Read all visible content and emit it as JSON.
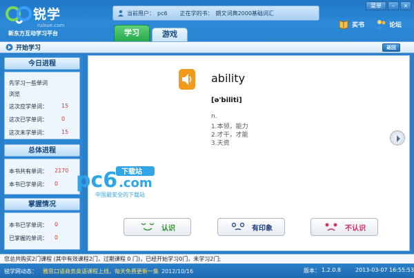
{
  "header": {
    "logo_text": "锐学",
    "logo_domain": "ruixue.com",
    "logo_slogan": "新东方互动学习平台",
    "current_user_label": "当前用户：",
    "current_user": "pc6",
    "current_book_label": "正在学的书：",
    "current_book": "朗文词典2000基础词汇",
    "tabs": [
      {
        "label": "学习"
      },
      {
        "label": "游戏"
      }
    ],
    "menu_label": "菜单",
    "min_label": "–",
    "close_label": "×",
    "buy_label": "买书",
    "forum_label": "论坛"
  },
  "toolbar": {
    "title": "开始学习",
    "back_label": "返回"
  },
  "sidebar": {
    "today_title": "今日进程",
    "today_desc_line1": "先学习一些单词",
    "today_desc_line2": "浏览",
    "today_rows": [
      {
        "label": "这次应学单词：",
        "value": "15"
      },
      {
        "label": "这次已学单词：",
        "value": "0"
      },
      {
        "label": "这次未学单词：",
        "value": "15"
      }
    ],
    "total_title": "总体进程",
    "total_rows": [
      {
        "label": "本书共有单词：",
        "value": "2170"
      },
      {
        "label": "本书已学单词：",
        "value": "0"
      }
    ],
    "mastery_title": "掌握情况",
    "mastery_rows": [
      {
        "label": "本书已学单词：",
        "value": "0"
      },
      {
        "label": "已掌握的单词：",
        "value": "0"
      }
    ]
  },
  "main": {
    "word": "ability",
    "phonetic": "[ə'biliti]",
    "pos": "n.",
    "defs": [
      "1.本领，能力",
      "2.才干，才能",
      "3.天资"
    ],
    "answers": {
      "know": "认识",
      "seen": "有印象",
      "unknown": "不认识"
    }
  },
  "watermark": {
    "brand": "pc6",
    "brand_domain": ".com",
    "tag": "下载站",
    "tagline": "中国最安全的下载站"
  },
  "status": {
    "text": "您总共购买2门课程 (其中有效课程2门，过期课程 0 门)，已经开始学习0门，未学习2门;"
  },
  "bottom": {
    "news_label": "锐学网动态：",
    "news_text": "雅思口语商务英语课程上线，每天免费更新一集",
    "news_date": "2012/10/16",
    "version_label": "版本：",
    "version": "1.2.0.8",
    "clock": "2013-03-07 16:55:53"
  },
  "colors": {
    "chrome_blue": "#2a7fc9",
    "accent_green": "#27a84a",
    "value_red": "#d9322b"
  }
}
